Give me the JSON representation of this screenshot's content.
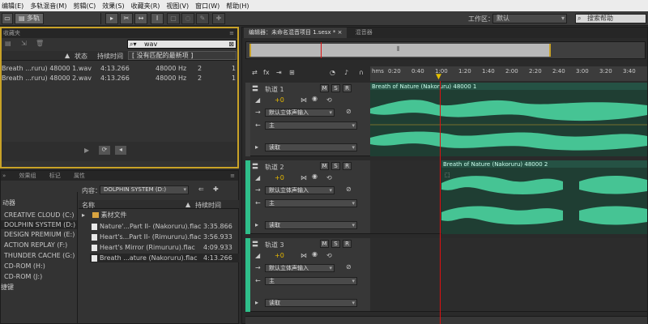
{
  "menu": [
    "编辑(E)",
    "多轨混音(M)",
    "剪辑(C)",
    "效果(S)",
    "收藏夹(R)",
    "视图(V)",
    "窗口(W)",
    "帮助(H)"
  ],
  "toolbar": {
    "view_label": "多轨",
    "workspace_label": "工作区：",
    "workspace_value": "默认",
    "help_search_placeholder": "搜索帮助"
  },
  "files_panel": {
    "tab": "收藏夹",
    "search_value": "wav",
    "search_hint": "[ 没有匹配的最新项 ]",
    "columns": [
      "状态",
      "持续时间"
    ],
    "rows": [
      {
        "name": "Breath ...ruru) 48000 1.wav",
        "duration": "4:13.266",
        "rate": "48000 Hz",
        "channels": "2",
        "extra": "1"
      },
      {
        "name": "Breath ...ruru) 48000 2.wav",
        "duration": "4:13.266",
        "rate": "48000 Hz",
        "channels": "2",
        "extra": "1"
      }
    ]
  },
  "browser_panel": {
    "tabs": [
      "效果组",
      "标记",
      "属性"
    ],
    "drives_header": "动器",
    "drives": [
      "CREATIVE CLOUD (C:)",
      "DOLPHIN SYSTEM (D:)",
      "DESIGN PREMIUM (E:)",
      "ACTION REPLAY (F:)",
      "THUNDER CACHE (G:)",
      "CD-ROM (H:)",
      "CD-ROM (J:)"
    ],
    "shortcuts": "捷键",
    "content_label": "内容：",
    "content_value": "DOLPHIN SYSTEM (D:)",
    "col_name": "名称",
    "col_duration": "持续时间",
    "files": [
      {
        "name": "素材文件",
        "duration": ""
      },
      {
        "name": "Nature'...Part II- (Nakoruru).flac",
        "duration": "3:35.866"
      },
      {
        "name": "Heart's...Part II- (Rimururu).flac",
        "duration": "3:56.933"
      },
      {
        "name": "Heart's Mirror (Rimururu).flac",
        "duration": "4:09.933"
      },
      {
        "name": "Breath ...ature (Nakoruru).flac",
        "duration": "4:13.266"
      }
    ]
  },
  "editor": {
    "tab_title": "编辑器：未命名混音项目 1.sesx *",
    "tab_mixer": "混音器",
    "ruler_unit": "hms",
    "ticks": [
      "0:20",
      "0:40",
      "1:00",
      "1:20",
      "1:40",
      "2:00",
      "2:20",
      "2:40",
      "3:00",
      "3:20",
      "3:40"
    ],
    "tracks": [
      {
        "name": "轨道 1",
        "volume": "+0",
        "input": "默认立体声输入",
        "output": "主",
        "mode": "读取",
        "clip": "Breath of Nature (Nakoruru) 48000 1"
      },
      {
        "name": "轨道 2",
        "volume": "+0",
        "input": "默认立体声输入",
        "output": "主",
        "mode": "读取",
        "clip": "Breath of Nature (Nakoruru) 48000 2"
      },
      {
        "name": "轨道 3",
        "volume": "+0",
        "input": "默认立体声输入",
        "output": "主",
        "mode": "读取",
        "clip": ""
      }
    ],
    "track_buttons": [
      "M",
      "S",
      "R"
    ]
  },
  "colors": {
    "accent_gold": "#c9a227",
    "wave_green": "#46c494",
    "track_green": "#2fbf8a",
    "playhead": "#dd1111"
  }
}
